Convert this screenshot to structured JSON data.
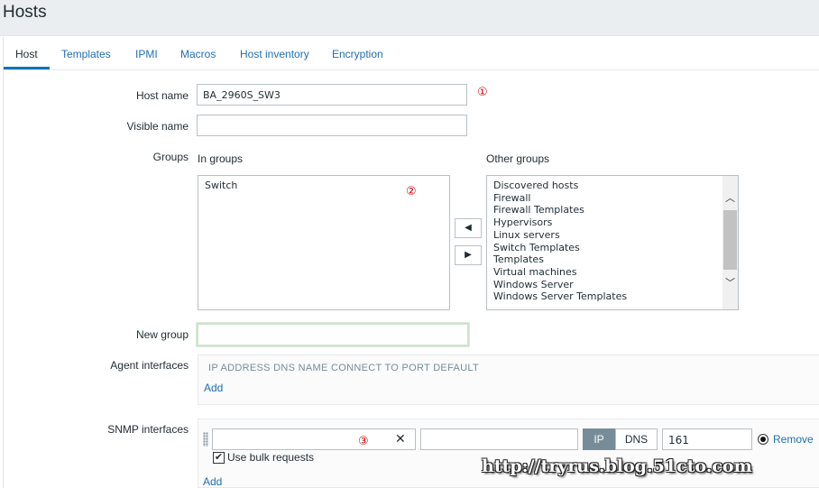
{
  "page": {
    "title": "Hosts"
  },
  "tabs": [
    "Host",
    "Templates",
    "IPMI",
    "Macros",
    "Host inventory",
    "Encryption"
  ],
  "form": {
    "host_name_label": "Host name",
    "host_name_value": "BA_2960S_SW3",
    "visible_name_label": "Visible name",
    "visible_name_value": "",
    "groups_label": "Groups",
    "in_groups_label": "In groups",
    "in_groups": [
      "Switch"
    ],
    "other_groups_label": "Other groups",
    "other_groups": [
      "Discovered hosts",
      "Firewall",
      "Firewall Templates",
      "Hypervisors",
      "Linux servers",
      "Switch Templates",
      "Templates",
      "Virtual machines",
      "Windows Server",
      "Windows Server Templates"
    ],
    "move_left": "◀",
    "move_right": "▶",
    "new_group_label": "New group",
    "new_group_value": ""
  },
  "agent_interfaces": {
    "label": "Agent interfaces",
    "header": "IP ADDRESS DNS NAME CONNECT TO PORT DEFAULT",
    "add": "Add"
  },
  "snmp_interfaces": {
    "label": "SNMP interfaces",
    "ip_value": "",
    "dns_value": "",
    "connect_ip": "IP",
    "connect_dns": "DNS",
    "port": "161",
    "remove": "Remove",
    "bulk_label": "Use bulk requests",
    "bulk_checked": "✔",
    "add": "Add"
  },
  "annotations": {
    "a1": "①",
    "a2": "②",
    "a3": "③"
  },
  "watermark": "http://tryrus.blog.51cto.com",
  "icons": {
    "clear": "✕",
    "scroll_up": "︿",
    "scroll_down": "﹀"
  }
}
